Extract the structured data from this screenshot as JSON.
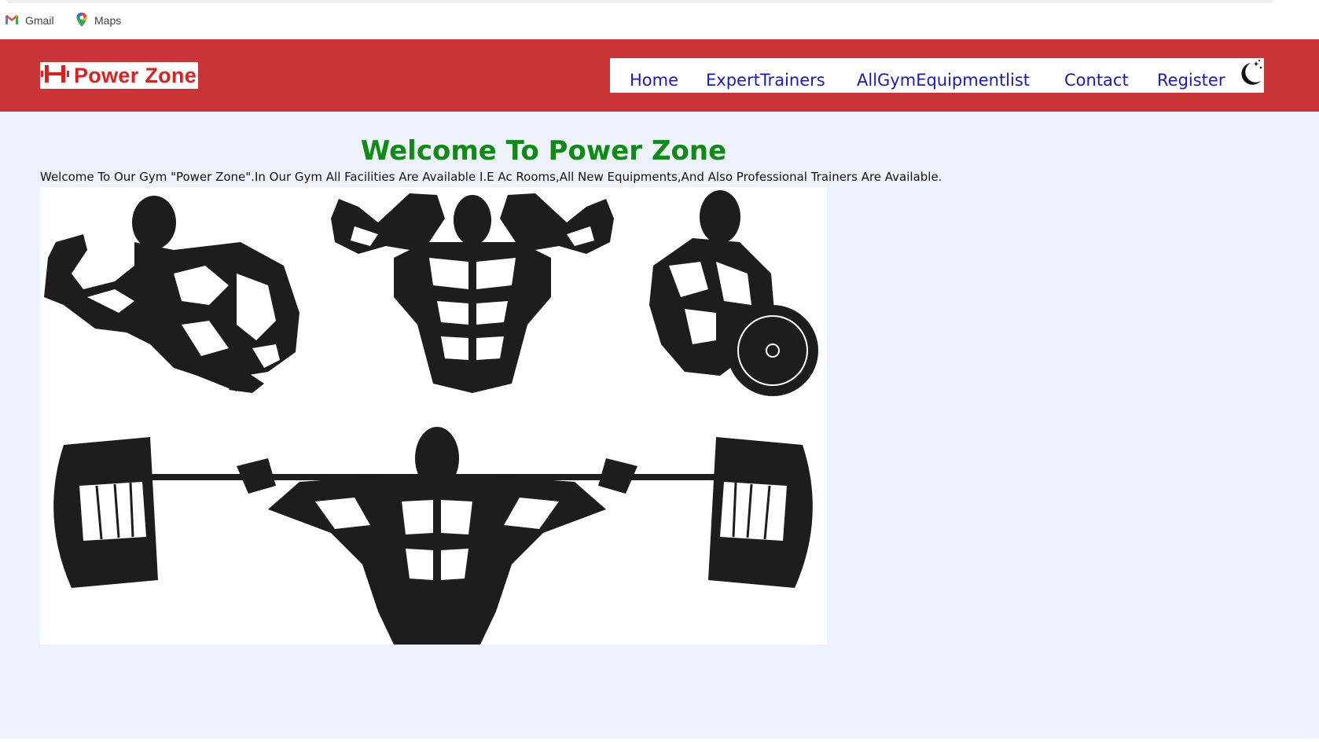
{
  "bookmarks": [
    {
      "label": "Gmail",
      "icon": "gmail-icon"
    },
    {
      "label": "Maps",
      "icon": "maps-pin-icon"
    }
  ],
  "header": {
    "logo_text": "Power Zone",
    "logo_icon": "dumbbell-icon",
    "brand_color": "#c93436",
    "nav": {
      "home": "Home",
      "trainers": "ExpertTrainers",
      "equipment": "AllGymEquipmentlist",
      "contact": "Contact",
      "register": "Register"
    },
    "theme_toggle_icon": "moon-icon"
  },
  "main": {
    "title": "Welcome To Power Zone",
    "intro": "Welcome To Our Gym \"Power Zone\".In Our Gym All Facilities Are Available I.E Ac Rooms,All New Equipments,And Also Professional Trainers Are Available.",
    "hero_image": "bodybuilders-illustration",
    "title_color": "#0e8a15",
    "background": "#eef2fb"
  }
}
